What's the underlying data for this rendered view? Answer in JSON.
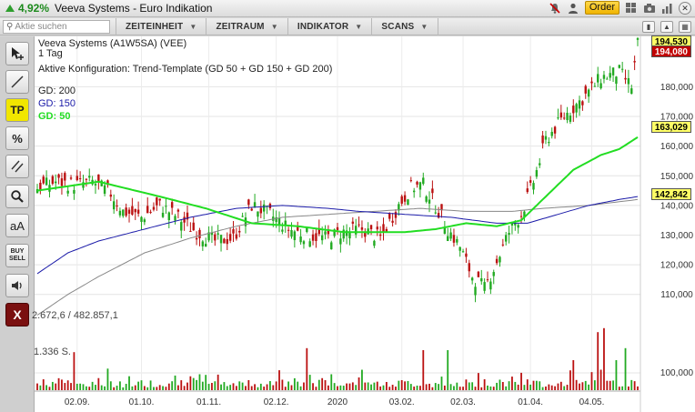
{
  "titlebar": {
    "change": "4,92%",
    "title": "Veeva Systems - Euro Indikation",
    "order_label": "Order"
  },
  "toolbar": {
    "search_placeholder": "Aktie suchen",
    "menus": [
      "ZEITEINHEIT",
      "ZEITRAUM",
      "INDIKATOR",
      "SCANS"
    ]
  },
  "tools": [
    {
      "name": "cursor-tool",
      "icon": "cursor-plus-icon"
    },
    {
      "name": "line-tool",
      "icon": "line-icon"
    },
    {
      "name": "tp-tool",
      "label": "TP"
    },
    {
      "name": "percent-tool",
      "label": "%"
    },
    {
      "name": "parallel-tool",
      "icon": "parallel-lines-icon"
    },
    {
      "name": "zoom-tool",
      "icon": "magnifier-icon"
    },
    {
      "name": "font-tool",
      "label": "aA"
    },
    {
      "name": "buy-sell-tool",
      "label1": "BUY",
      "label2": "SELL"
    },
    {
      "name": "sound-tool",
      "icon": "speaker-icon"
    },
    {
      "name": "close-tool",
      "label": "X"
    }
  ],
  "chart": {
    "instrument": "Veeva Systems (A1W5SA) (VEE)",
    "interval": "1 Tag",
    "config": "Aktive Konfiguration: Trend-Template (GD 50 + GD 150 + GD 200)",
    "legend": [
      {
        "label": "GD: 200",
        "color": "#888888"
      },
      {
        "label": "GD: 150",
        "color": "#1a1aa8"
      },
      {
        "label": "GD: 50",
        "color": "#22dd22"
      }
    ],
    "volume_label_top": "2.672,6 / 482.857,1",
    "volume_label_mid": "1.336 S.",
    "price_tags": [
      {
        "value": "194,530",
        "bg": "#ffff66",
        "fg": "#000000"
      },
      {
        "value": "194,080",
        "bg": "#c00000",
        "fg": "#ffffff"
      },
      {
        "value": "163,029",
        "bg": "#ffff66",
        "fg": "#000000"
      },
      {
        "value": "142,842",
        "bg": "#ffff66",
        "fg": "#000000"
      }
    ],
    "colors": {
      "up": "#22aa22",
      "down": "#bb1111",
      "ma50": "#22dd22",
      "ma150": "#1a1aa8",
      "ma200": "#888888"
    }
  },
  "chart_data": {
    "type": "candlestick",
    "y_ticks": [
      110000,
      120000,
      130000,
      140000,
      150000,
      160000,
      170000,
      180000
    ],
    "y_tick_labels": [
      "110,000",
      "120,000",
      "130,000",
      "140,000",
      "150,000",
      "160,000",
      "170,000",
      "180,000"
    ],
    "volume_tick_label": "100,000",
    "ylim": [
      105,
      197
    ],
    "x_tick_labels": [
      "02.09.",
      "01.10.",
      "01.11.",
      "02.12.",
      "2020",
      "03.02.",
      "02.03.",
      "01.04.",
      "04.05."
    ],
    "x_tick_index": [
      13,
      34,
      56,
      78,
      98,
      119,
      139,
      161,
      181
    ],
    "n_candles": 197,
    "close_path": [
      [
        0,
        146
      ],
      [
        6,
        148
      ],
      [
        12,
        147
      ],
      [
        18,
        148
      ],
      [
        24,
        144
      ],
      [
        28,
        138
      ],
      [
        34,
        136
      ],
      [
        40,
        140
      ],
      [
        46,
        136
      ],
      [
        52,
        131
      ],
      [
        58,
        128
      ],
      [
        64,
        129
      ],
      [
        70,
        140
      ],
      [
        76,
        137
      ],
      [
        82,
        132
      ],
      [
        88,
        130
      ],
      [
        94,
        129
      ],
      [
        100,
        131
      ],
      [
        106,
        132
      ],
      [
        112,
        129
      ],
      [
        118,
        140
      ],
      [
        122,
        146
      ],
      [
        126,
        147
      ],
      [
        130,
        140
      ],
      [
        134,
        132
      ],
      [
        138,
        126
      ],
      [
        142,
        116
      ],
      [
        146,
        112
      ],
      [
        150,
        121
      ],
      [
        154,
        131
      ],
      [
        158,
        137
      ],
      [
        162,
        148
      ],
      [
        166,
        162
      ],
      [
        172,
        170
      ],
      [
        178,
        176
      ],
      [
        184,
        183
      ],
      [
        190,
        185
      ],
      [
        194,
        180
      ],
      [
        196,
        194.5
      ]
    ],
    "ma50": [
      [
        0,
        145
      ],
      [
        20,
        148
      ],
      [
        40,
        143
      ],
      [
        55,
        139
      ],
      [
        70,
        134
      ],
      [
        85,
        133
      ],
      [
        100,
        131
      ],
      [
        110,
        131
      ],
      [
        120,
        131
      ],
      [
        130,
        132
      ],
      [
        140,
        134
      ],
      [
        150,
        133
      ],
      [
        158,
        135
      ],
      [
        166,
        143
      ],
      [
        175,
        152
      ],
      [
        184,
        157
      ],
      [
        190,
        159
      ],
      [
        196,
        163
      ]
    ],
    "ma150": [
      [
        0,
        117
      ],
      [
        10,
        124
      ],
      [
        20,
        128
      ],
      [
        35,
        132
      ],
      [
        50,
        136
      ],
      [
        65,
        139
      ],
      [
        80,
        140
      ],
      [
        95,
        139
      ],
      [
        105,
        138
      ],
      [
        120,
        137
      ],
      [
        135,
        136
      ],
      [
        150,
        134
      ],
      [
        160,
        134
      ],
      [
        170,
        137
      ],
      [
        180,
        140
      ],
      [
        190,
        142
      ],
      [
        196,
        143
      ]
    ],
    "ma200": [
      [
        0,
        103
      ],
      [
        10,
        110
      ],
      [
        20,
        116
      ],
      [
        35,
        124
      ],
      [
        50,
        129
      ],
      [
        65,
        133
      ],
      [
        80,
        136
      ],
      [
        95,
        137
      ],
      [
        110,
        138
      ],
      [
        125,
        139
      ],
      [
        140,
        138
      ],
      [
        155,
        138
      ],
      [
        165,
        139
      ],
      [
        180,
        140
      ],
      [
        196,
        142
      ]
    ],
    "volume_spikes": [
      [
        12,
        19
      ],
      [
        88,
        21
      ],
      [
        126,
        20
      ],
      [
        134,
        20
      ],
      [
        175,
        15
      ],
      [
        183,
        29
      ],
      [
        185,
        31
      ],
      [
        189,
        15
      ],
      [
        192,
        21
      ]
    ]
  }
}
